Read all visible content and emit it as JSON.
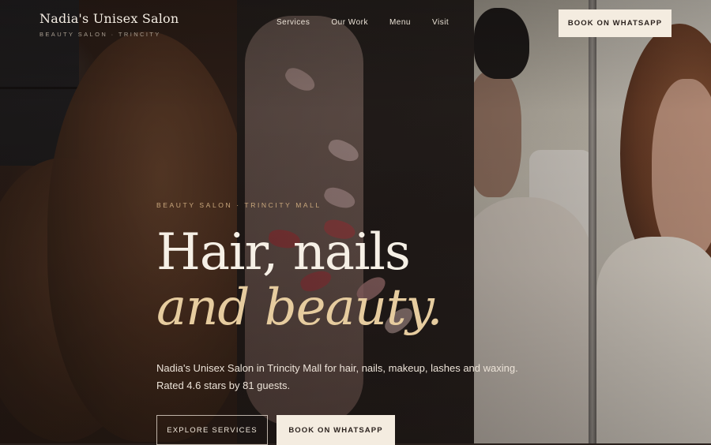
{
  "brand": {
    "name": "Nadia's Unisex Salon",
    "tagline": "BEAUTY SALON · TRINCITY"
  },
  "nav": {
    "items": [
      "Services",
      "Our Work",
      "Menu",
      "Visit"
    ],
    "cta": "BOOK ON WHATSAPP"
  },
  "hero": {
    "eyebrow": "BEAUTY SALON · TRINCITY MALL",
    "title_line1": "Hair, nails",
    "title_line2": "and beauty.",
    "description_line1": "Nadia's Unisex Salon in Trincity Mall for hair, nails, makeup, lashes and waxing.",
    "description_line2": "Rated 4.6 stars by 81 guests.",
    "primary_button": "EXPLORE SERVICES",
    "secondary_button": "BOOK ON WHATSAPP"
  },
  "colors": {
    "accent_gold": "#c9a77c",
    "cream": "#f4ece0",
    "italic_title": "#e6cc9f"
  }
}
